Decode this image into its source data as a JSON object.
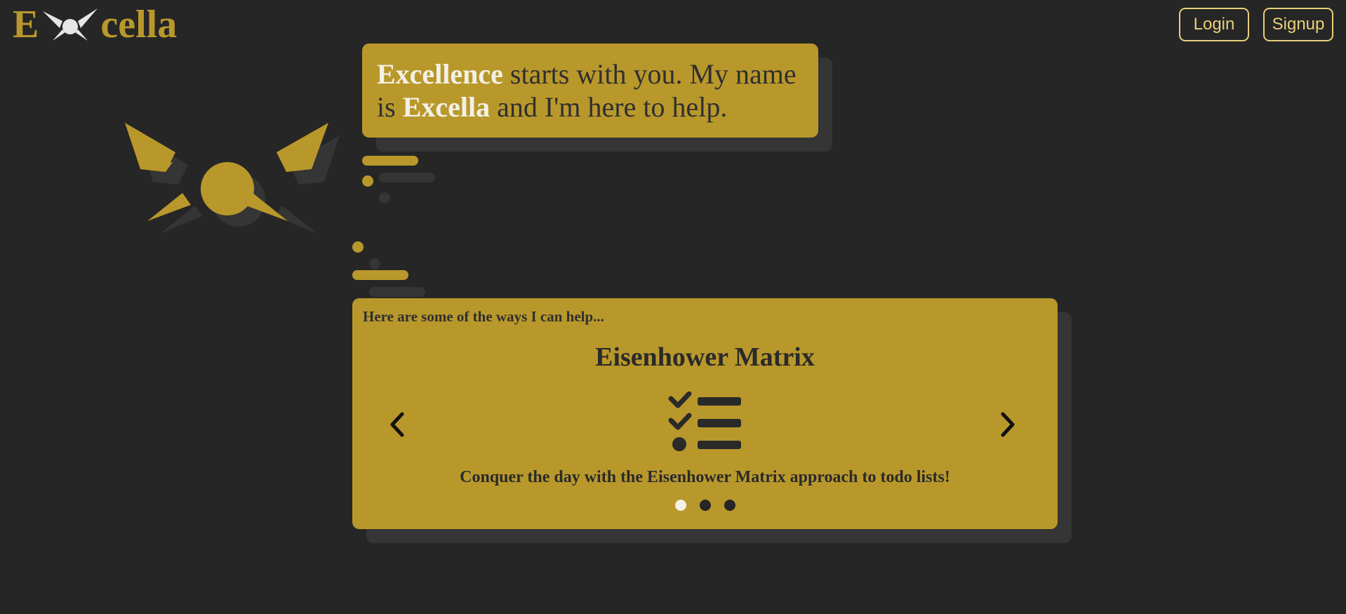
{
  "header": {
    "logo_first": "E",
    "logo_rest": "cella",
    "login_label": "Login",
    "signup_label": "Signup"
  },
  "bubble": {
    "bold_1": "Excellence",
    "text_1": " starts with you. My name is ",
    "bold_2": "Excella",
    "text_2": " and I'm here to help."
  },
  "carousel": {
    "intro": "Here are some of the ways I can help...",
    "title": "Eisenhower Matrix",
    "icon": "checklist-icon",
    "description": "Conquer the day with the Eisenhower Matrix approach to todo lists!",
    "slide_count": 3,
    "active_slide": 1
  },
  "colors": {
    "background": "#262626",
    "accent": "#b9982b",
    "shadow": "#353535",
    "button_border": "#e9cf7a",
    "highlight_text": "#f3f0e6"
  }
}
